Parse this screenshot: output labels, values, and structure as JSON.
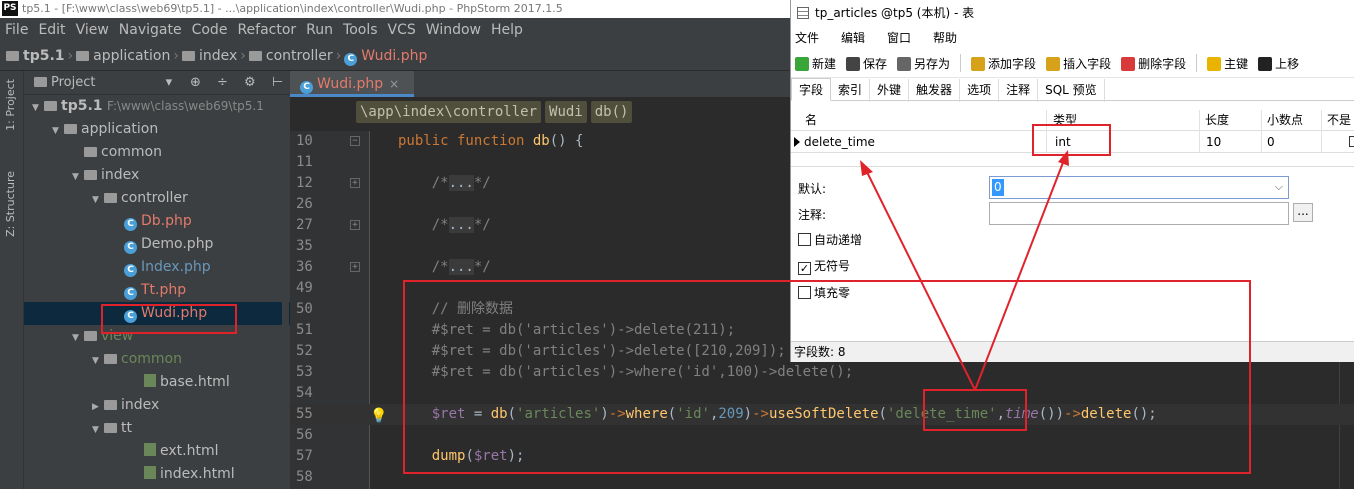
{
  "ide": {
    "title": "tp5.1 - [F:\\www\\class\\web69\\tp5.1] - ...\\application\\index\\controller\\Wudi.php - PhpStorm 2017.1.5",
    "logo": "PS",
    "menu": [
      "File",
      "Edit",
      "View",
      "Navigate",
      "Code",
      "Refactor",
      "Run",
      "Tools",
      "VCS",
      "Window",
      "Help"
    ],
    "breadcrumbs": [
      "tp5.1",
      "application",
      "index",
      "controller",
      "Wudi.php"
    ]
  },
  "tool_strip": {
    "project_tab": "1: Project",
    "structure_tab": "Z: Structure"
  },
  "project_panel": {
    "header": "Project",
    "header_arrow": "▾",
    "tools": "⊕ ÷ ⚙ ⊢",
    "tree": [
      {
        "label": "tp5.1",
        "path": "F:\\www\\class\\web69\\tp5.1",
        "type": "root",
        "indent": 0,
        "expanded": true
      },
      {
        "label": "application",
        "type": "folder",
        "indent": 1,
        "expanded": true
      },
      {
        "label": "common",
        "type": "folder",
        "indent": 2,
        "expanded": false,
        "leaf": true
      },
      {
        "label": "index",
        "type": "folder",
        "indent": 2,
        "expanded": true
      },
      {
        "label": "controller",
        "type": "folder",
        "indent": 3,
        "expanded": true
      },
      {
        "label": "Db.php",
        "type": "php-red",
        "indent": 4
      },
      {
        "label": "Demo.php",
        "type": "php-plain",
        "indent": 4
      },
      {
        "label": "Index.php",
        "type": "php-blue",
        "indent": 4
      },
      {
        "label": "Tt.php",
        "type": "php-red",
        "indent": 4
      },
      {
        "label": "Wudi.php",
        "type": "php-red",
        "indent": 4,
        "selected": true
      },
      {
        "label": "view",
        "type": "view",
        "indent": 2,
        "expanded": true
      },
      {
        "label": "common",
        "type": "view",
        "indent": 3,
        "expanded": true
      },
      {
        "label": "base.html",
        "type": "html",
        "indent": 5
      },
      {
        "label": "index",
        "type": "folder",
        "indent": 3,
        "expanded": false
      },
      {
        "label": "tt",
        "type": "folder",
        "indent": 3,
        "expanded": true
      },
      {
        "label": "ext.html",
        "type": "html",
        "indent": 5
      },
      {
        "label": "index.html",
        "type": "html",
        "indent": 5
      }
    ]
  },
  "editor": {
    "tab_label": "Wudi.php",
    "tab_close": "×",
    "breadcrumb": [
      "\\app\\index\\controller",
      "Wudi",
      "db()"
    ],
    "lines": [
      {
        "n": "10",
        "fold": "−",
        "tokens": [
          [
            "kw",
            "public function "
          ],
          [
            "fn",
            "db"
          ],
          [
            "plain",
            "() {"
          ]
        ]
      },
      {
        "n": "11",
        "tokens": []
      },
      {
        "n": "12",
        "fold": "+",
        "tokens": [
          [
            "cmt",
            "    /*"
          ],
          [
            "dots",
            "..."
          ],
          [
            "cmt",
            "*/"
          ]
        ]
      },
      {
        "n": "26",
        "tokens": []
      },
      {
        "n": "27",
        "fold": "+",
        "tokens": [
          [
            "cmt",
            "    /*"
          ],
          [
            "dots",
            "..."
          ],
          [
            "cmt",
            "*/"
          ]
        ]
      },
      {
        "n": "35",
        "tokens": []
      },
      {
        "n": "36",
        "fold": "+",
        "tokens": [
          [
            "cmt",
            "    /*"
          ],
          [
            "dots",
            "..."
          ],
          [
            "cmt",
            "*/"
          ]
        ]
      },
      {
        "n": "49",
        "tokens": []
      },
      {
        "n": "50",
        "tokens": [
          [
            "cmt",
            "    // 删除数据"
          ]
        ]
      },
      {
        "n": "51",
        "tokens": [
          [
            "cmt",
            "    #$ret = db('articles')->delete(211);"
          ]
        ]
      },
      {
        "n": "52",
        "tokens": [
          [
            "cmt",
            "    #$ret = db('articles')->delete([210,209]);"
          ]
        ]
      },
      {
        "n": "53",
        "tokens": [
          [
            "cmt",
            "    #$ret = db('articles')->where('id',100)->delete();"
          ]
        ]
      },
      {
        "n": "54",
        "tokens": []
      },
      {
        "n": "55",
        "bulb": true,
        "current": true,
        "tokens": [
          [
            "var",
            "    $ret"
          ],
          [
            "plain",
            " = "
          ],
          [
            "fn",
            "db"
          ],
          [
            "plain",
            "("
          ],
          [
            "str",
            "'articles'"
          ],
          [
            "plain",
            ")"
          ],
          [
            "kw",
            "->"
          ],
          [
            "fn",
            "where"
          ],
          [
            "plain",
            "("
          ],
          [
            "str",
            "'id'"
          ],
          [
            "plain",
            ","
          ],
          [
            "num",
            "209"
          ],
          [
            "plain",
            ")"
          ],
          [
            "kw",
            "->"
          ],
          [
            "fn",
            "useSoftDelete"
          ],
          [
            "plain",
            "("
          ],
          [
            "str",
            "'delete_time'"
          ],
          [
            "plain",
            ","
          ],
          [
            "ital",
            "time"
          ],
          [
            "plain",
            "())"
          ],
          [
            "kw",
            "->"
          ],
          [
            "fn",
            "delete"
          ],
          [
            "plain",
            "();"
          ]
        ]
      },
      {
        "n": "56",
        "tokens": []
      },
      {
        "n": "57",
        "tokens": [
          [
            "fn",
            "    dump"
          ],
          [
            "plain",
            "("
          ],
          [
            "var",
            "$ret"
          ],
          [
            "plain",
            ");"
          ]
        ]
      },
      {
        "n": "58",
        "tokens": []
      }
    ]
  },
  "navicat": {
    "title": "tp_articles @tp5 (本机) - 表",
    "menu": [
      "文件",
      "编辑",
      "窗口",
      "帮助"
    ],
    "toolbar": [
      {
        "label": "新建",
        "icon": "plus-icon",
        "color": "#3aa63a"
      },
      {
        "label": "保存",
        "icon": "save-icon",
        "color": "#444444"
      },
      {
        "label": "另存为",
        "icon": "save-as-icon",
        "color": "#666666"
      },
      {
        "label": "添加字段",
        "icon": "add-field-icon",
        "color": "#d6a21a"
      },
      {
        "label": "插入字段",
        "icon": "insert-field-icon",
        "color": "#d6a21a"
      },
      {
        "label": "删除字段",
        "icon": "delete-field-icon",
        "color": "#d83a3a"
      },
      {
        "label": "主键",
        "icon": "key-icon",
        "color": "#e8b400"
      },
      {
        "label": "上移",
        "icon": "arrow-up-icon",
        "color": "#222222"
      }
    ],
    "tabs": [
      "字段",
      "索引",
      "外键",
      "触发器",
      "选项",
      "注释",
      "SQL 预览"
    ],
    "columns": [
      "名",
      "类型",
      "长度",
      "小数点",
      "不是"
    ],
    "field": {
      "name": "delete_time",
      "type": "int",
      "length": "10",
      "decimals": "0"
    },
    "props": {
      "default_label": "默认:",
      "default_value": "0",
      "comment_label": "注释:",
      "comment_value": "",
      "dots": "...",
      "auto_increment": "自动递增",
      "unsigned": "无符号",
      "zerofill": "填充零",
      "unsigned_checked": true
    },
    "status": "字段数: 8"
  },
  "annotation_color": "#e0232b"
}
